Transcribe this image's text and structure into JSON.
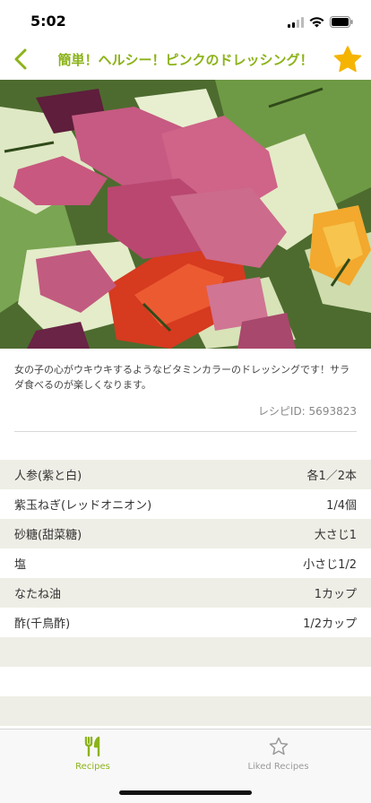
{
  "status": {
    "time": "5:02"
  },
  "nav": {
    "title": "簡単！ヘルシー！ピンクのドレッシング！"
  },
  "recipe": {
    "description": "女の子の心がウキウキするようなビタミンカラーのドレッシングです！サラダ食べるのが楽しくなります。",
    "id_label": "レシピID: 5693823"
  },
  "ingredients": [
    {
      "name": "人参(紫と白)",
      "amount": "各1／2本"
    },
    {
      "name": "紫玉ねぎ(レッドオニオン)",
      "amount": "1/4個"
    },
    {
      "name": "砂糖(甜菜糖)",
      "amount": "大さじ1"
    },
    {
      "name": "塩",
      "amount": "小さじ1/2"
    },
    {
      "name": "なたね油",
      "amount": "1カップ"
    },
    {
      "name": "酢(千鳥酢)",
      "amount": "1/2カップ"
    }
  ],
  "tabs": [
    {
      "label": "Recipes",
      "icon": "fork-knife-icon",
      "active": true
    },
    {
      "label": "Liked Recipes",
      "icon": "star-outline-icon",
      "active": false
    }
  ],
  "colors": {
    "accent": "#8cb31a",
    "star": "#f5b400",
    "row_alt": "#efeee6",
    "inactive": "#9a9a9a"
  }
}
